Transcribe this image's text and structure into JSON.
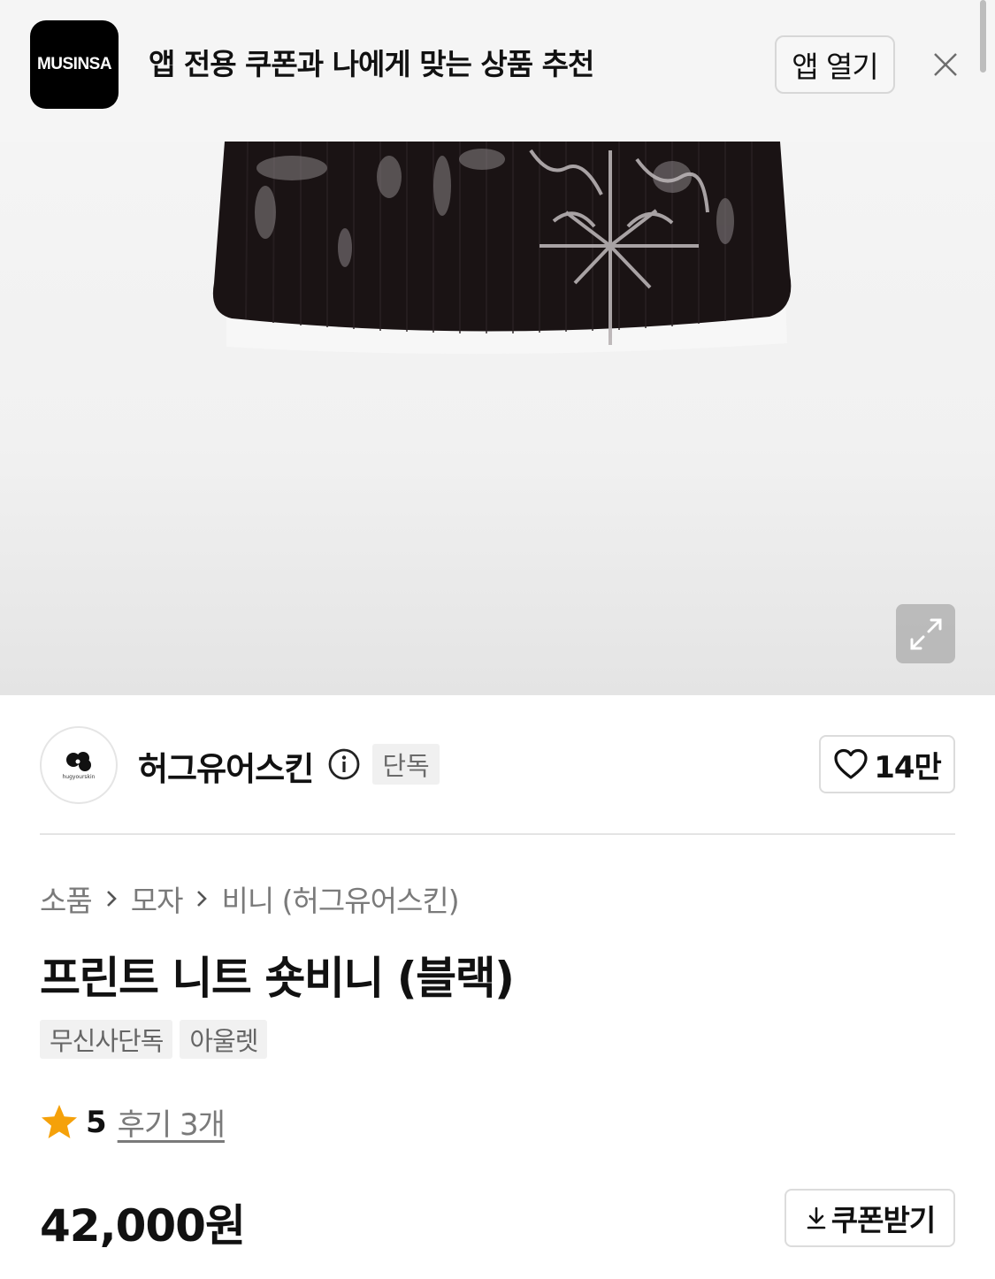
{
  "banner": {
    "logo_text": "MUSINSA",
    "message": "앱 전용 쿠폰과 나에게 맞는 상품 추천",
    "open_app_label": "앱 열기",
    "close_icon": "close-icon"
  },
  "product_image": {
    "expand_icon": "expand-icon"
  },
  "brand": {
    "logo_text": "hugyourskin",
    "name": "허그유어스킨",
    "info_icon": "info-icon",
    "badge": "단독",
    "likes": "14만",
    "heart_icon": "heart-icon"
  },
  "breadcrumb": {
    "items": [
      "소품",
      "모자",
      "비니 (허그유어스킨)"
    ],
    "separator_icon": "chevron-right-icon"
  },
  "product": {
    "title": "프린트 니트 숏비니 (블랙)",
    "tags": [
      "무신사단독",
      "아울렛"
    ],
    "rating": "5",
    "review_link": "후기 3개",
    "star_color": "#f5a10a",
    "price": "42,000원",
    "coupon_label": "쿠폰받기",
    "download_icon": "download-icon"
  }
}
